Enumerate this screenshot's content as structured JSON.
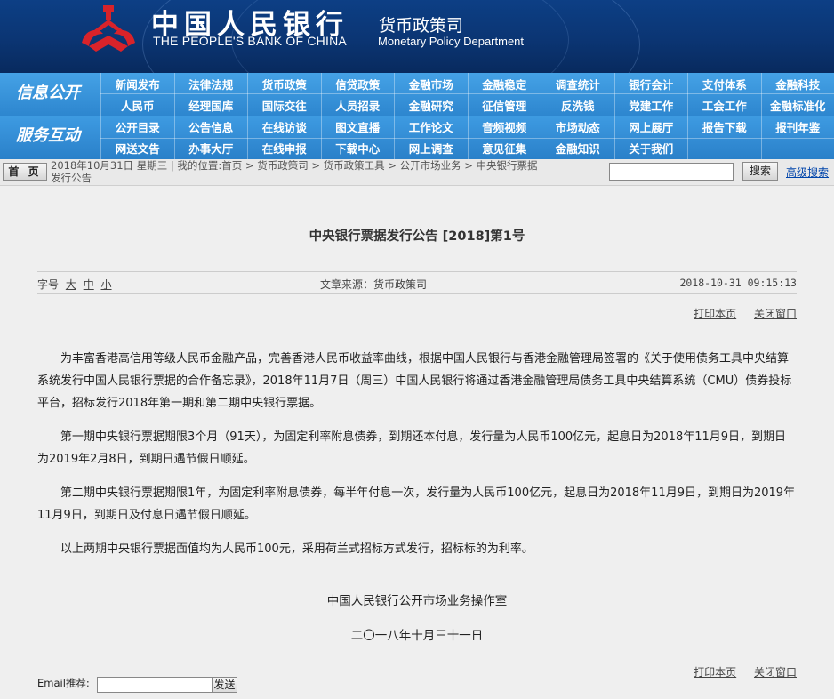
{
  "header": {
    "bank_cn": "中国人民银行",
    "bank_en": "THE PEOPLE'S BANK OF CHINA",
    "dept_cn": "货币政策司",
    "dept_en": "Monetary Policy Department",
    "logo_icon": "pboc-logo-icon",
    "logo_color": "#d8232a"
  },
  "nav": {
    "section1_title": "信息公开",
    "section2_title": "服务互动",
    "row1": [
      "新闻发布",
      "法律法规",
      "货币政策",
      "信贷政策",
      "金融市场",
      "金融稳定",
      "调查统计",
      "银行会计",
      "支付体系",
      "金融科技"
    ],
    "row2": [
      "人民币",
      "经理国库",
      "国际交往",
      "人员招录",
      "金融研究",
      "征信管理",
      "反洗钱",
      "党建工作",
      "工会工作",
      "金融标准化"
    ],
    "row3": [
      "公开目录",
      "公告信息",
      "在线访谈",
      "图文直播",
      "工作论文",
      "音频视频",
      "市场动态",
      "网上展厅",
      "报告下载",
      "报刊年鉴"
    ],
    "row4": [
      "网送文告",
      "办事大厅",
      "在线申报",
      "下载中心",
      "网上调查",
      "意见征集",
      "金融知识",
      "关于我们",
      "",
      ""
    ]
  },
  "crumb": {
    "home_label": "首 页",
    "line1": "2018年10月31日  星期三  |  我的位置:首页  >  货币政策司  >  货币政策工具  >  公开市场业务  >  中央银行票据",
    "line2": "发行公告",
    "search_button": "搜索",
    "advanced_search": "高级搜索",
    "search_value": ""
  },
  "article": {
    "title": "中央银行票据发行公告 [2018]第1号",
    "font_size_label": "字号",
    "font_large": "大",
    "font_medium": "中",
    "font_small": "小",
    "source": "文章来源：货币政策司",
    "date": "2018-10-31  09:15:13",
    "print": "打印本页",
    "close": "关闭窗口",
    "paragraphs": [
      "为丰富香港高信用等级人民币金融产品，完善香港人民币收益率曲线，根据中国人民银行与香港金融管理局签署的《关于使用债务工具中央结算系统发行中国人民银行票据的合作备忘录》，2018年11月7日（周三）中国人民银行将通过香港金融管理局债务工具中央结算系统（CMU）债券投标平台，招标发行2018年第一期和第二期中央银行票据。",
      "第一期中央银行票据期限3个月（91天），为固定利率附息债券，到期还本付息，发行量为人民币100亿元，起息日为2018年11月9日，到期日为2019年2月8日，到期日遇节假日顺延。",
      "第二期中央银行票据期限1年，为固定利率附息债券，每半年付息一次，发行量为人民币100亿元，起息日为2018年11月9日，到期日为2019年11月9日，到期日及付息日遇节假日顺延。",
      "以上两期中央银行票据面值均为人民币100元，采用荷兰式招标方式发行，招标标的为利率。"
    ],
    "signature": "中国人民银行公开市场业务操作室",
    "sign_date": "二〇一八年十月三十一日"
  },
  "email": {
    "label": "Email推荐:",
    "button": "发送",
    "value": ""
  }
}
